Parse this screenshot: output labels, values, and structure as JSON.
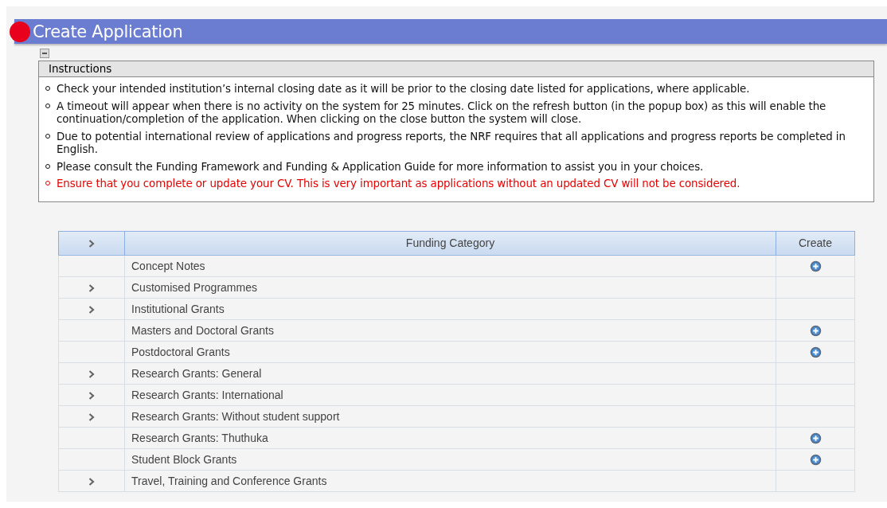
{
  "header": {
    "title": "Create Application"
  },
  "instructions": {
    "title": "Instructions",
    "collapse": {
      "expanded": true
    },
    "items": [
      {
        "kind": "note",
        "text": "Check your intended institution’s internal closing date as it will be prior to the closing date listed for applications, where applicable."
      },
      {
        "kind": "note",
        "text": "A timeout will appear when there is no activity on the system for 25 minutes. Click on the refresh button (in the popup box) as this will enable the continuation/completion of the application. When clicking on the close button the system will close."
      },
      {
        "kind": "note",
        "text": "Due to potential international review of applications and progress reports, the NRF requires that all applications and progress reports be completed in English."
      },
      {
        "kind": "note",
        "text": "Please consult the Funding Framework and Funding & Application Guide for more information to assist you in your choices."
      },
      {
        "kind": "warning",
        "text": "Ensure that you complete or update your CV. This is very important as applications without an updated CV will not be considered."
      }
    ]
  },
  "table": {
    "columns": [
      "Funding Category",
      "Create"
    ],
    "rows": [
      {
        "category": "Concept Notes",
        "expandable": false,
        "can_create": true
      },
      {
        "category": "Customised Programmes",
        "expandable": true,
        "can_create": false
      },
      {
        "category": "Institutional Grants",
        "expandable": true,
        "can_create": false
      },
      {
        "category": "Masters and Doctoral Grants",
        "expandable": false,
        "can_create": true
      },
      {
        "category": "Postdoctoral Grants",
        "expandable": false,
        "can_create": true
      },
      {
        "category": "Research Grants: General",
        "expandable": true,
        "can_create": false
      },
      {
        "category": "Research Grants: International",
        "expandable": true,
        "can_create": false
      },
      {
        "category": "Research Grants: Without student support",
        "expandable": true,
        "can_create": false
      },
      {
        "category": "Research Grants: Thuthuka",
        "expandable": false,
        "can_create": true
      },
      {
        "category": "Student Block Grants",
        "expandable": false,
        "can_create": true
      },
      {
        "category": "Travel, Training and Conference Grants",
        "expandable": true,
        "can_create": false
      }
    ]
  }
}
